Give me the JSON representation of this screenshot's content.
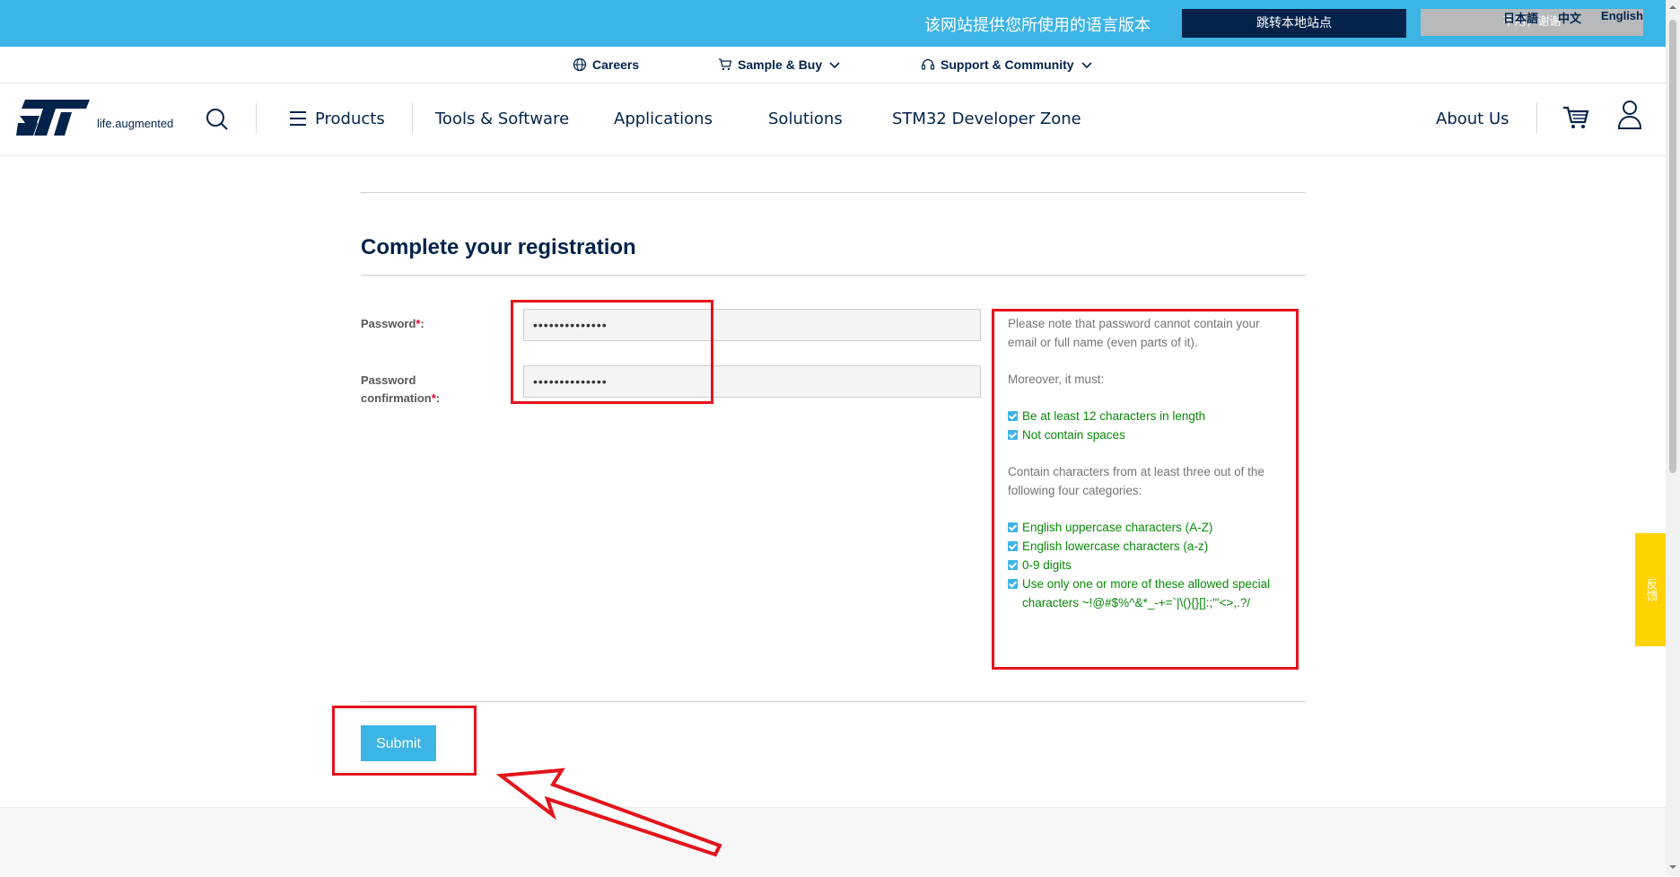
{
  "banner": {
    "message": "该网站提供您所使用的语言版本",
    "goto_local": "跳转本地站点",
    "no_thanks": "不用，谢谢",
    "languages": [
      "日本語",
      "中文",
      "English"
    ]
  },
  "subnav": {
    "careers": "Careers",
    "sample_buy": "Sample & Buy",
    "support": "Support & Community"
  },
  "header": {
    "logo_text": "ST",
    "tagline": "life.augmented",
    "nav": [
      "Products",
      "Tools & Software",
      "Applications",
      "Solutions",
      "STM32 Developer Zone"
    ],
    "about": "About Us"
  },
  "form": {
    "title": "Complete your registration",
    "password_label": "Password",
    "password_confirm_label_1": "Password",
    "password_confirm_label_2": "confirmation",
    "required_mark": "*",
    "colon": ":",
    "password_value": "••••••••••••••",
    "password_confirm_value": "••••••••••••••",
    "submit_label": "Submit"
  },
  "rules": {
    "note": "Please note that password cannot contain your email or full name (even parts of it).",
    "moreover": "Moreover, it must:",
    "must": [
      "Be at least 12 characters in length",
      "Not contain spaces"
    ],
    "categories_intro": "Contain characters from at least three out of the following four categories:",
    "categories": [
      "English uppercase characters (A-Z)",
      "English lowercase characters (a-z)",
      "0-9 digits",
      "Use only one or more of these allowed special characters ~!@#$%^&*_-+=`|\\(){}[]:;\"'<>,.?/"
    ]
  },
  "feedback": {
    "label": "反馈"
  },
  "colors": {
    "banner_blue": "#3cb4e5",
    "navy": "#03234b",
    "rule_green": "#098a09",
    "annotation_red": "#e4141b",
    "feedback_yellow": "#ffd200"
  }
}
